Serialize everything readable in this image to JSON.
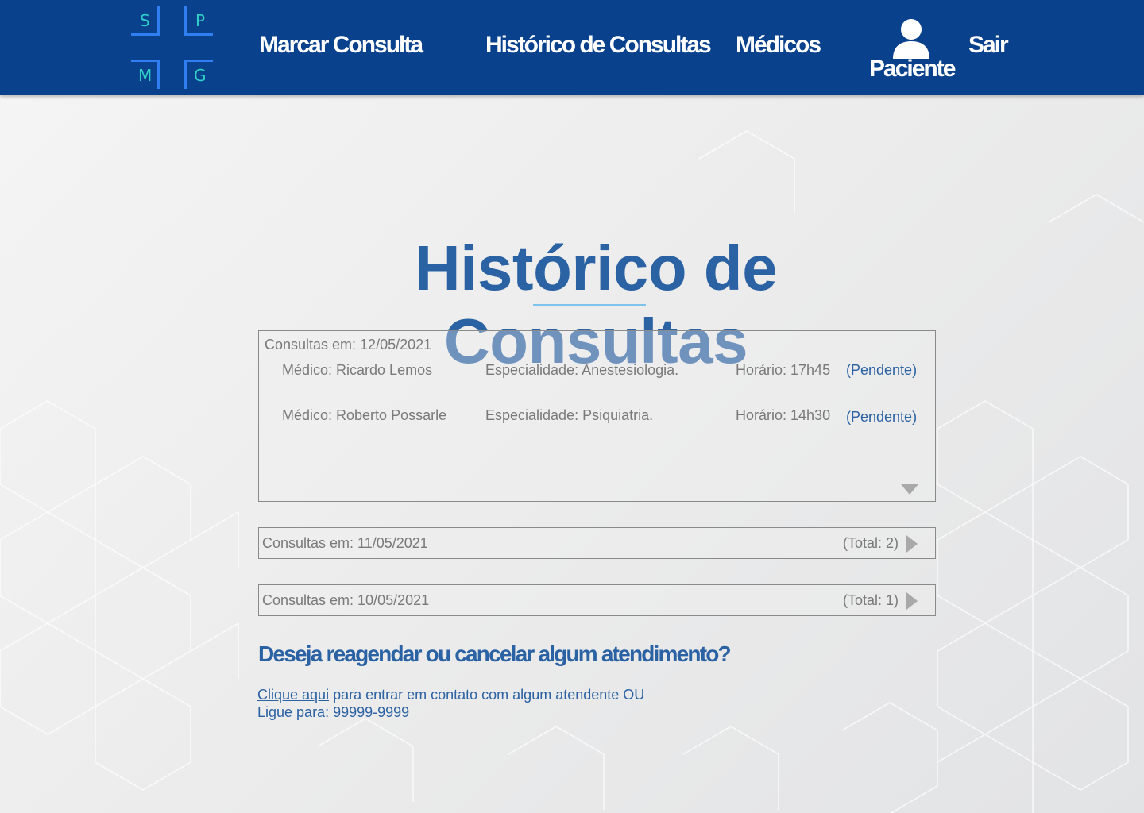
{
  "logo": {
    "letters": [
      "S",
      "P",
      "M",
      "G"
    ]
  },
  "nav": {
    "marcar": "Marcar Consulta",
    "historico": "Histórico de Consultas",
    "medicos": "Médicos",
    "user": "Paciente",
    "sair": "Sair"
  },
  "page": {
    "title": "Histórico de Consultas"
  },
  "groups": [
    {
      "label": "Consultas em: 12/05/2021",
      "expanded": true,
      "items": [
        {
          "medico": "Médico: Ricardo Lemos",
          "especialidade": "Especialidade: Anestesiologia.",
          "horario": "Horário: 17h45",
          "status": "(Pendente)"
        },
        {
          "medico": "Médico: Roberto Possarle",
          "especialidade": "Especialidade: Psiquiatria.",
          "horario": "Horário: 14h30",
          "status": "(Pendente)"
        }
      ]
    },
    {
      "label": "Consultas em: 11/05/2021",
      "total": "(Total: 2)",
      "expanded": false
    },
    {
      "label": "Consultas em: 10/05/2021",
      "total": "(Total: 1)",
      "expanded": false
    }
  ],
  "help": {
    "question": "Deseja reagendar ou cancelar algum atendimento?",
    "link": "Clique aqui",
    "text": " para entrar em contato com algum atendente OU",
    "phone": "Ligue para: 99999-9999"
  },
  "colors": {
    "header": "#0a418c",
    "accent": "#2b62a3",
    "underline": "#7ec3eb",
    "logo_text": "#2fd0c8",
    "logo_lines": "#2f7ff3"
  }
}
